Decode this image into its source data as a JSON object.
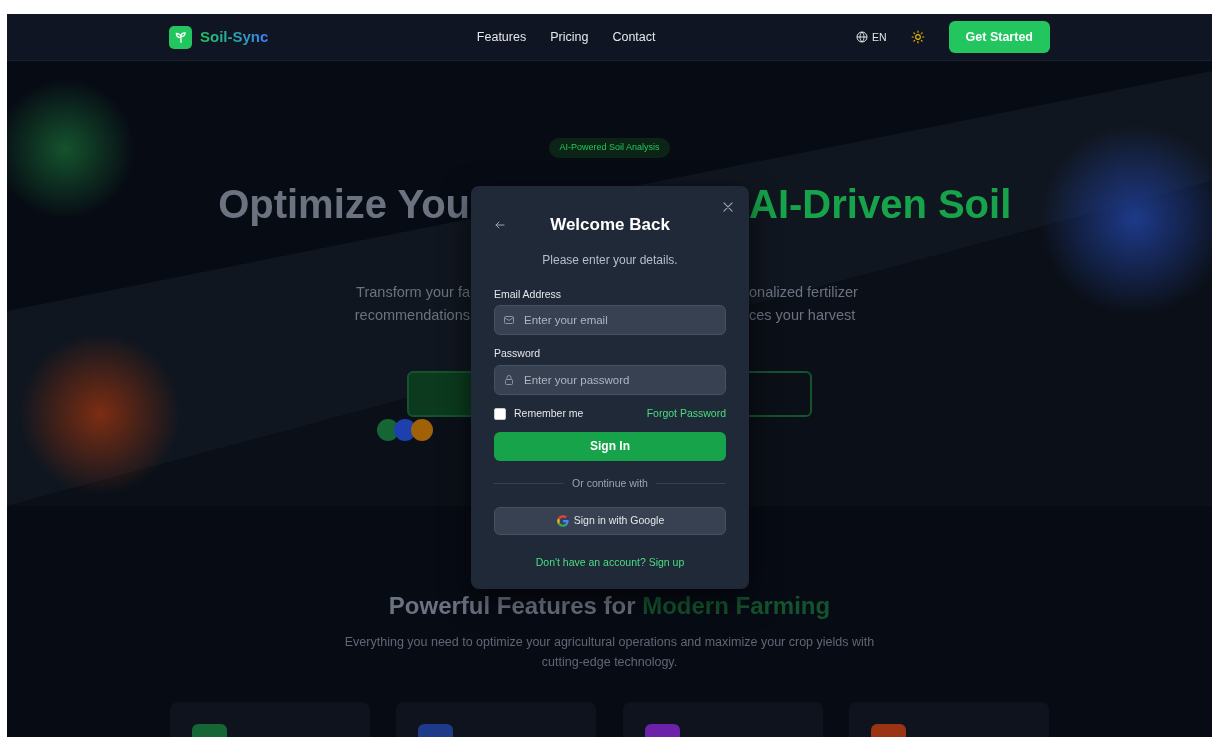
{
  "nav": {
    "brand": "Soil-Sync",
    "links": [
      "Features",
      "Pricing",
      "Contact"
    ],
    "language": "EN",
    "cta": "Get Started"
  },
  "hero": {
    "badge": "AI-Powered Soil Analysis",
    "headline_left": "Optimize You",
    "headline_right": "AI-Driven Soil",
    "lead_left": [
      "Transform your fa",
      "recommendations"
    ],
    "lead_right": [
      "onalized fertilizer",
      "ces your harvest"
    ],
    "avatars": [
      {
        "color": "#166534"
      },
      {
        "color": "#1e40af"
      },
      {
        "color": "#a16207"
      }
    ]
  },
  "features": {
    "heading": "Powerful Features for",
    "heading_accent": "Modern Farming",
    "subtitle": "Everything you need to optimize your agricultural operations and maximize your crop yields with cutting-edge technology.",
    "cards": [
      {
        "color": "#166534"
      },
      {
        "color": "#1e3a8a"
      },
      {
        "color": "#6b21a8"
      },
      {
        "color": "#9a3412"
      }
    ]
  },
  "modal": {
    "title": "Welcome Back",
    "subtitle": "Please enter your details.",
    "fields": [
      {
        "label": "Email Address",
        "placeholder": "Enter your email",
        "kind": "email"
      },
      {
        "label": "Password",
        "placeholder": "Enter your password",
        "kind": "password"
      }
    ],
    "remember": {
      "label": "Remember me",
      "checked": false
    },
    "forgot": "Forgot Password",
    "submit": "Sign In",
    "divider": "Or continue with",
    "google": "Sign in with Google",
    "signup": "Don't have an account? Sign up"
  }
}
